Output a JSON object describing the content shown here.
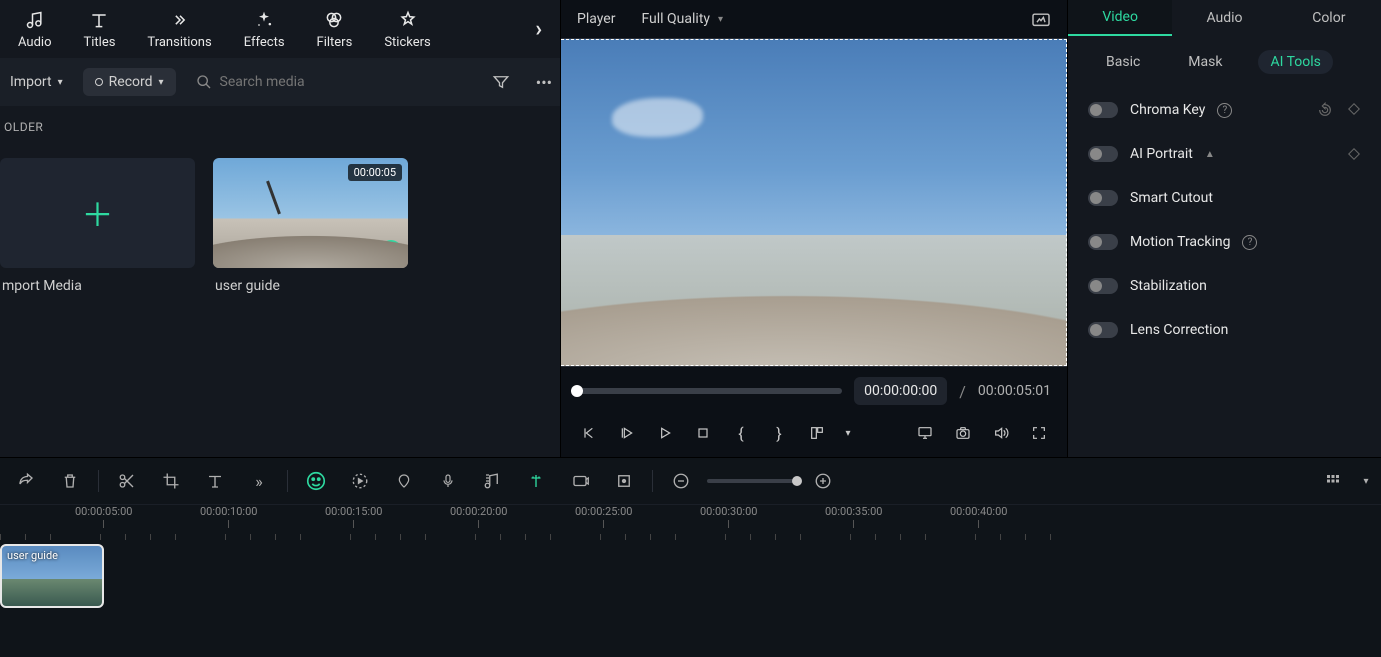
{
  "tabs": {
    "audio": "Audio",
    "titles": "Titles",
    "transitions": "Transitions",
    "effects": "Effects",
    "filters": "Filters",
    "stickers": "Stickers"
  },
  "toolbar": {
    "import": "Import",
    "record": "Record",
    "search_placeholder": "Search media"
  },
  "folder_label": "OLDER",
  "media": {
    "import_label": "mport Media",
    "clip": {
      "duration": "00:00:05",
      "label": "user guide"
    }
  },
  "player": {
    "label": "Player",
    "quality": "Full Quality",
    "time_current": "00:00:00:00",
    "time_sep": "/",
    "time_duration": "00:00:05:01"
  },
  "props": {
    "tabs": {
      "video": "Video",
      "audio": "Audio",
      "color": "Color"
    },
    "subtabs": {
      "basic": "Basic",
      "mask": "Mask",
      "ai": "AI Tools"
    },
    "chroma": "Chroma Key",
    "portrait": "AI Portrait",
    "cutout": "Smart Cutout",
    "tracking": "Motion Tracking",
    "stab": "Stabilization",
    "lens": "Lens Correction"
  },
  "timeline": {
    "ticks": [
      "00:00:05:00",
      "00:00:10:00",
      "00:00:15:00",
      "00:00:20:00",
      "00:00:25:00",
      "00:00:30:00",
      "00:00:35:00",
      "00:00:40:00"
    ],
    "clip_label": "user guide"
  }
}
